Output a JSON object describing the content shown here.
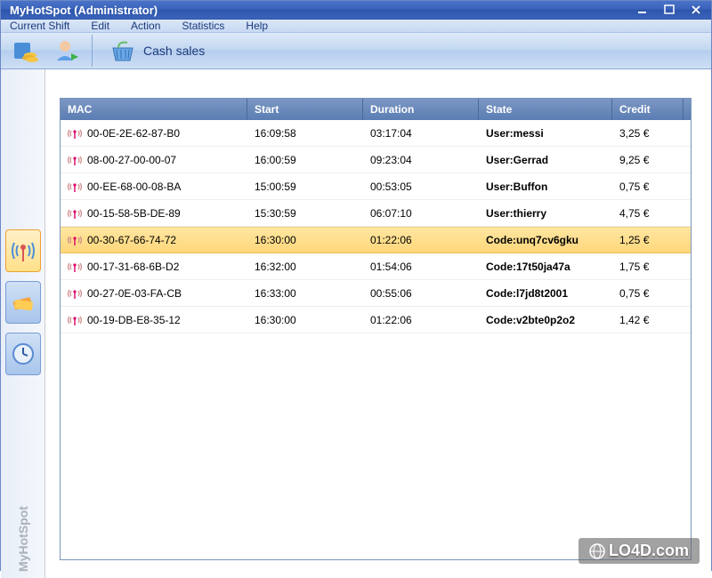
{
  "window": {
    "title": "MyHotSpot   (Administrator)"
  },
  "menus": {
    "current_shift": "Current Shift",
    "edit": "Edit",
    "action": "Action",
    "statistics": "Statistics",
    "help": "Help"
  },
  "toolbar": {
    "cash_sales": "Cash sales"
  },
  "sidebar": {
    "brand": "MyHotSpot"
  },
  "table": {
    "headers": {
      "mac": "MAC",
      "start": "Start",
      "duration": "Duration",
      "state": "State",
      "credit": "Credit"
    },
    "rows": [
      {
        "mac": "00-0E-2E-62-87-B0",
        "start": "16:09:58",
        "duration": "03:17:04",
        "state": "User:messi",
        "credit": "3,25 €",
        "selected": false
      },
      {
        "mac": "08-00-27-00-00-07",
        "start": "16:00:59",
        "duration": "09:23:04",
        "state": "User:Gerrad",
        "credit": "9,25 €",
        "selected": false
      },
      {
        "mac": "00-EE-68-00-08-BA",
        "start": "15:00:59",
        "duration": "00:53:05",
        "state": "User:Buffon",
        "credit": "0,75 €",
        "selected": false
      },
      {
        "mac": "00-15-58-5B-DE-89",
        "start": "15:30:59",
        "duration": "06:07:10",
        "state": "User:thierry",
        "credit": "4,75 €",
        "selected": false
      },
      {
        "mac": "00-30-67-66-74-72",
        "start": "16:30:00",
        "duration": "01:22:06",
        "state": "Code:unq7cv6gku",
        "credit": "1,25 €",
        "selected": true
      },
      {
        "mac": "00-17-31-68-6B-D2",
        "start": "16:32:00",
        "duration": "01:54:06",
        "state": "Code:17t50ja47a",
        "credit": "1,75 €",
        "selected": false
      },
      {
        "mac": "00-27-0E-03-FA-CB",
        "start": "16:33:00",
        "duration": "00:55:06",
        "state": "Code:l7jd8t2001",
        "credit": "0,75 €",
        "selected": false
      },
      {
        "mac": "00-19-DB-E8-35-12",
        "start": "16:30:00",
        "duration": "01:22:06",
        "state": "Code:v2bte0p2o2",
        "credit": "1,42 €",
        "selected": false
      }
    ]
  },
  "watermark": "LO4D.com"
}
